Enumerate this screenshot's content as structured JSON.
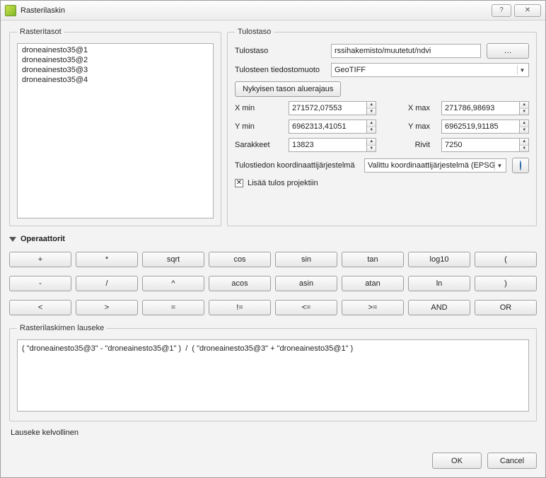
{
  "window": {
    "title": "Rasterilaskin"
  },
  "layers": {
    "legend": "Rasteritasot",
    "items": [
      "droneainesto35@1",
      "droneainesto35@2",
      "droneainesto35@3",
      "droneainesto35@4"
    ]
  },
  "output": {
    "legend": "Tulostaso",
    "layer_label": "Tulostaso",
    "layer_value": "rssihakemisto/muutetut/ndvi",
    "browse": "…",
    "format_label": "Tulosteen tiedostomuoto",
    "format_value": "GeoTIFF",
    "extent_button": "Nykyisen tason aluerajaus",
    "xmin_label": "X min",
    "xmin": "271572,07553",
    "xmax_label": "X max",
    "xmax": "271786,98693",
    "ymin_label": "Y min",
    "ymin": "6962313,41051",
    "ymax_label": "Y max",
    "ymax": "6962519,91185",
    "cols_label": "Sarakkeet",
    "cols": "13823",
    "rows_label": "Rivit",
    "rows": "7250",
    "crs_label": "Tulostiedon koordinaattijärjestelmä",
    "crs_value": "Valittu koordinaattijärjestelmä (EPSG",
    "add_label": "Lisää tulos projektiin"
  },
  "operators": {
    "legend": "Operaattorit",
    "row1": [
      "+",
      "*",
      "sqrt",
      "cos",
      "sin",
      "tan",
      "log10",
      "("
    ],
    "row2": [
      "-",
      "/",
      "^",
      "acos",
      "asin",
      "atan",
      "ln",
      ")"
    ],
    "row3": [
      "<",
      ">",
      "=",
      "!=",
      "<=",
      ">=",
      "AND",
      "OR"
    ]
  },
  "expression": {
    "legend": "Rasterilaskimen lauseke",
    "value": "( \"droneainesto35@3\" - \"droneainesto35@1\" )  /  ( \"droneainesto35@3\" + \"droneainesto35@1\" )"
  },
  "status": "Lauseke kelvollinen",
  "buttons": {
    "ok": "OK",
    "cancel": "Cancel"
  }
}
